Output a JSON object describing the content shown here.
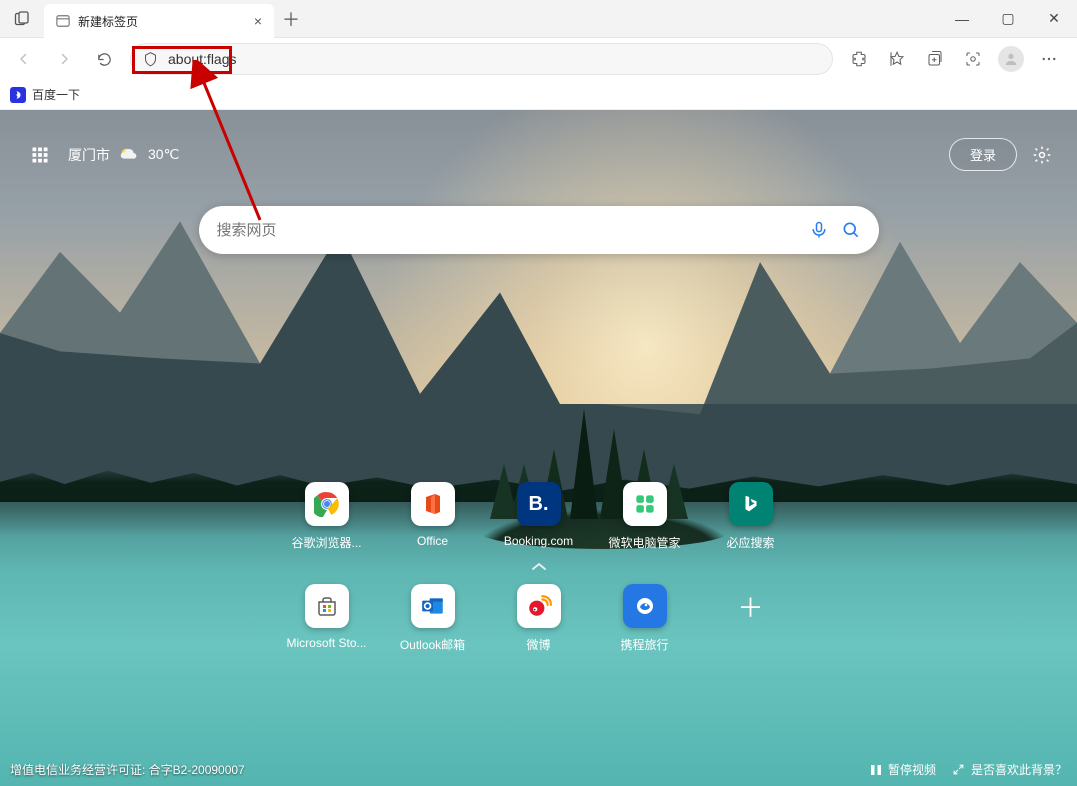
{
  "titlebar": {
    "tab_title": "新建标签页",
    "tab_close": "×",
    "newtab": "＋",
    "min": "—",
    "max": "▢",
    "close": "✕"
  },
  "toolbar": {
    "url": "about:flags"
  },
  "bookmarks": {
    "items": [
      {
        "label": "百度一下"
      }
    ]
  },
  "ntp": {
    "city": "厦门市",
    "temp": "30℃",
    "login": "登录",
    "search_placeholder": "搜索网页",
    "license": "增值电信业务经营许可证: 合字B2-20090007",
    "pause": "暂停视频",
    "ask_bg": "是否喜欢此背景？",
    "quicklinks": [
      {
        "label": "谷歌浏览器...",
        "bg": "#ffffff",
        "glyph": "chrome"
      },
      {
        "label": "Office",
        "bg": "#ffffff",
        "glyph": "office"
      },
      {
        "label": "Booking.com",
        "bg": "#003580",
        "glyph": "booking"
      },
      {
        "label": "微软电脑管家",
        "bg": "#ffffff",
        "glyph": "guanjia"
      },
      {
        "label": "必应搜索",
        "bg": "#008373",
        "glyph": "bing"
      },
      {
        "label": "Microsoft Sto...",
        "bg": "#ffffff",
        "glyph": "msstore"
      },
      {
        "label": "Outlook邮箱",
        "bg": "#ffffff",
        "glyph": "outlook"
      },
      {
        "label": "微博",
        "bg": "#ffffff",
        "glyph": "weibo"
      },
      {
        "label": "携程旅行",
        "bg": "#2577e3",
        "glyph": "ctrip"
      }
    ]
  }
}
